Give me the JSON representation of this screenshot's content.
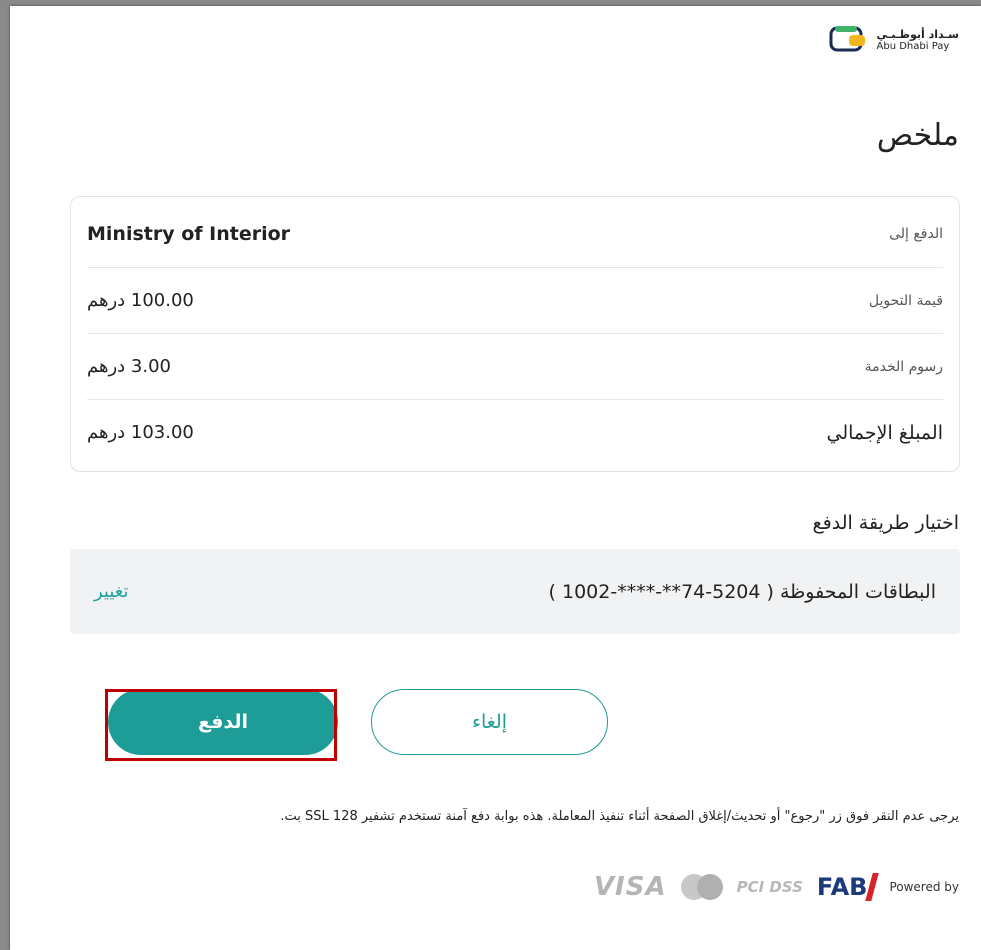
{
  "brand": {
    "name_ar": "سـداد أبوظـبـي",
    "name_en": "Abu Dhabi Pay",
    "logo_colors": {
      "primary": "#1a2a55",
      "accent": "#f2b51c",
      "green": "#3fb36b"
    }
  },
  "page_title": "ملخص",
  "summary": {
    "rows": [
      {
        "label": "الدفع إلى",
        "value": "Ministry of Interior"
      },
      {
        "label": "قيمة التحويل",
        "value": "100.00 درهم"
      },
      {
        "label": "رسوم الخدمة",
        "value": "3.00 درهم"
      },
      {
        "label": "المبلغ الإجمالي",
        "value": "103.00 درهم"
      }
    ]
  },
  "payment_method": {
    "title": "اختيار طريقة الدفع",
    "saved_card": "البطاقات المحفوظة ( 5204-74**-****-1002 )",
    "change_label": "تغيير"
  },
  "buttons": {
    "pay": "الدفع",
    "cancel": "إلغاء"
  },
  "note": "يرجى عدم النقر فوق زر \"رجوع\" أو تحديث/إغلاق الصفحة أثناء تنفيذ المعاملة. هذه بوابة دفع آمنة تستخدم تشفير SSL 128 بت.",
  "footer": {
    "visa": "VISA",
    "pci": "PCI DSS",
    "fab": "FAB",
    "powered_by": "Powered by"
  },
  "colors": {
    "teal": "#1e9c98",
    "highlight": "#c00000"
  }
}
